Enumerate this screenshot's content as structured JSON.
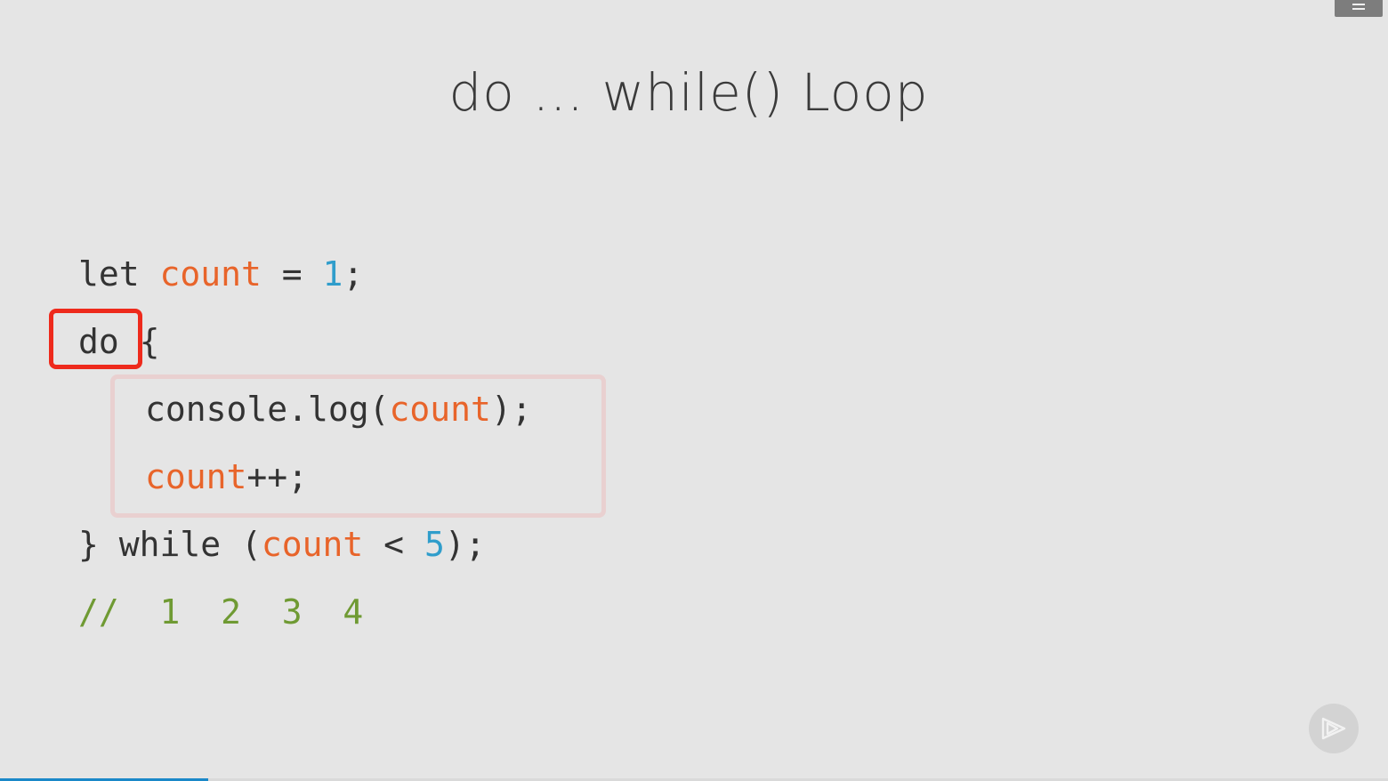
{
  "slide": {
    "title": "do … while() Loop"
  },
  "code": {
    "line1": {
      "kw": "let ",
      "var": "count",
      "mid": " = ",
      "num": "1",
      "end": ";"
    },
    "line2": {
      "kw": "do ",
      "brace": "{"
    },
    "line3": {
      "pre": "console.log(",
      "var": "count",
      "end": ");"
    },
    "line4": {
      "var": "count",
      "end": "++;"
    },
    "line5": {
      "pre": "} while (",
      "var": "count",
      "mid": " < ",
      "num": "5",
      "end": ");"
    },
    "line6": {
      "comment": "//  1  2  3  4"
    }
  },
  "playback": {
    "progress": 0.15
  },
  "colors": {
    "background": "#e5e5e5",
    "variable": "#e8642a",
    "number": "#2f9dcb",
    "comment": "#6f9a33",
    "highlight": "#ee2a1c"
  },
  "icons": {
    "menu": "hamburger-menu-icon",
    "logo": "pluralsight-play-icon"
  }
}
